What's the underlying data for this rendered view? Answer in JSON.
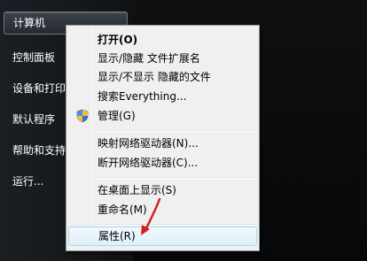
{
  "start_menu": {
    "items": [
      {
        "label": "计算机"
      },
      {
        "label": "控制面板"
      },
      {
        "label": "设备和打印机"
      },
      {
        "label": "默认程序"
      },
      {
        "label": "帮助和支持"
      },
      {
        "label": "运行..."
      }
    ]
  },
  "context_menu": {
    "items": [
      {
        "label": "打开(O)"
      },
      {
        "label": "显示/隐藏 文件扩展名"
      },
      {
        "label": "显示/不显示 隐藏的文件"
      },
      {
        "label": "搜索Everything..."
      },
      {
        "label": "管理(G)",
        "icon": "uac-shield-icon"
      },
      {
        "label": "映射网络驱动器(N)..."
      },
      {
        "label": "断开网络驱动器(C)..."
      },
      {
        "label": "在桌面上显示(S)"
      },
      {
        "label": "重命名(M)"
      },
      {
        "label": "属性(R)"
      }
    ]
  },
  "colors": {
    "annotation_arrow": "#d81e1e",
    "menu_background": "#f0f0f0",
    "highlight": "#deeffa"
  }
}
